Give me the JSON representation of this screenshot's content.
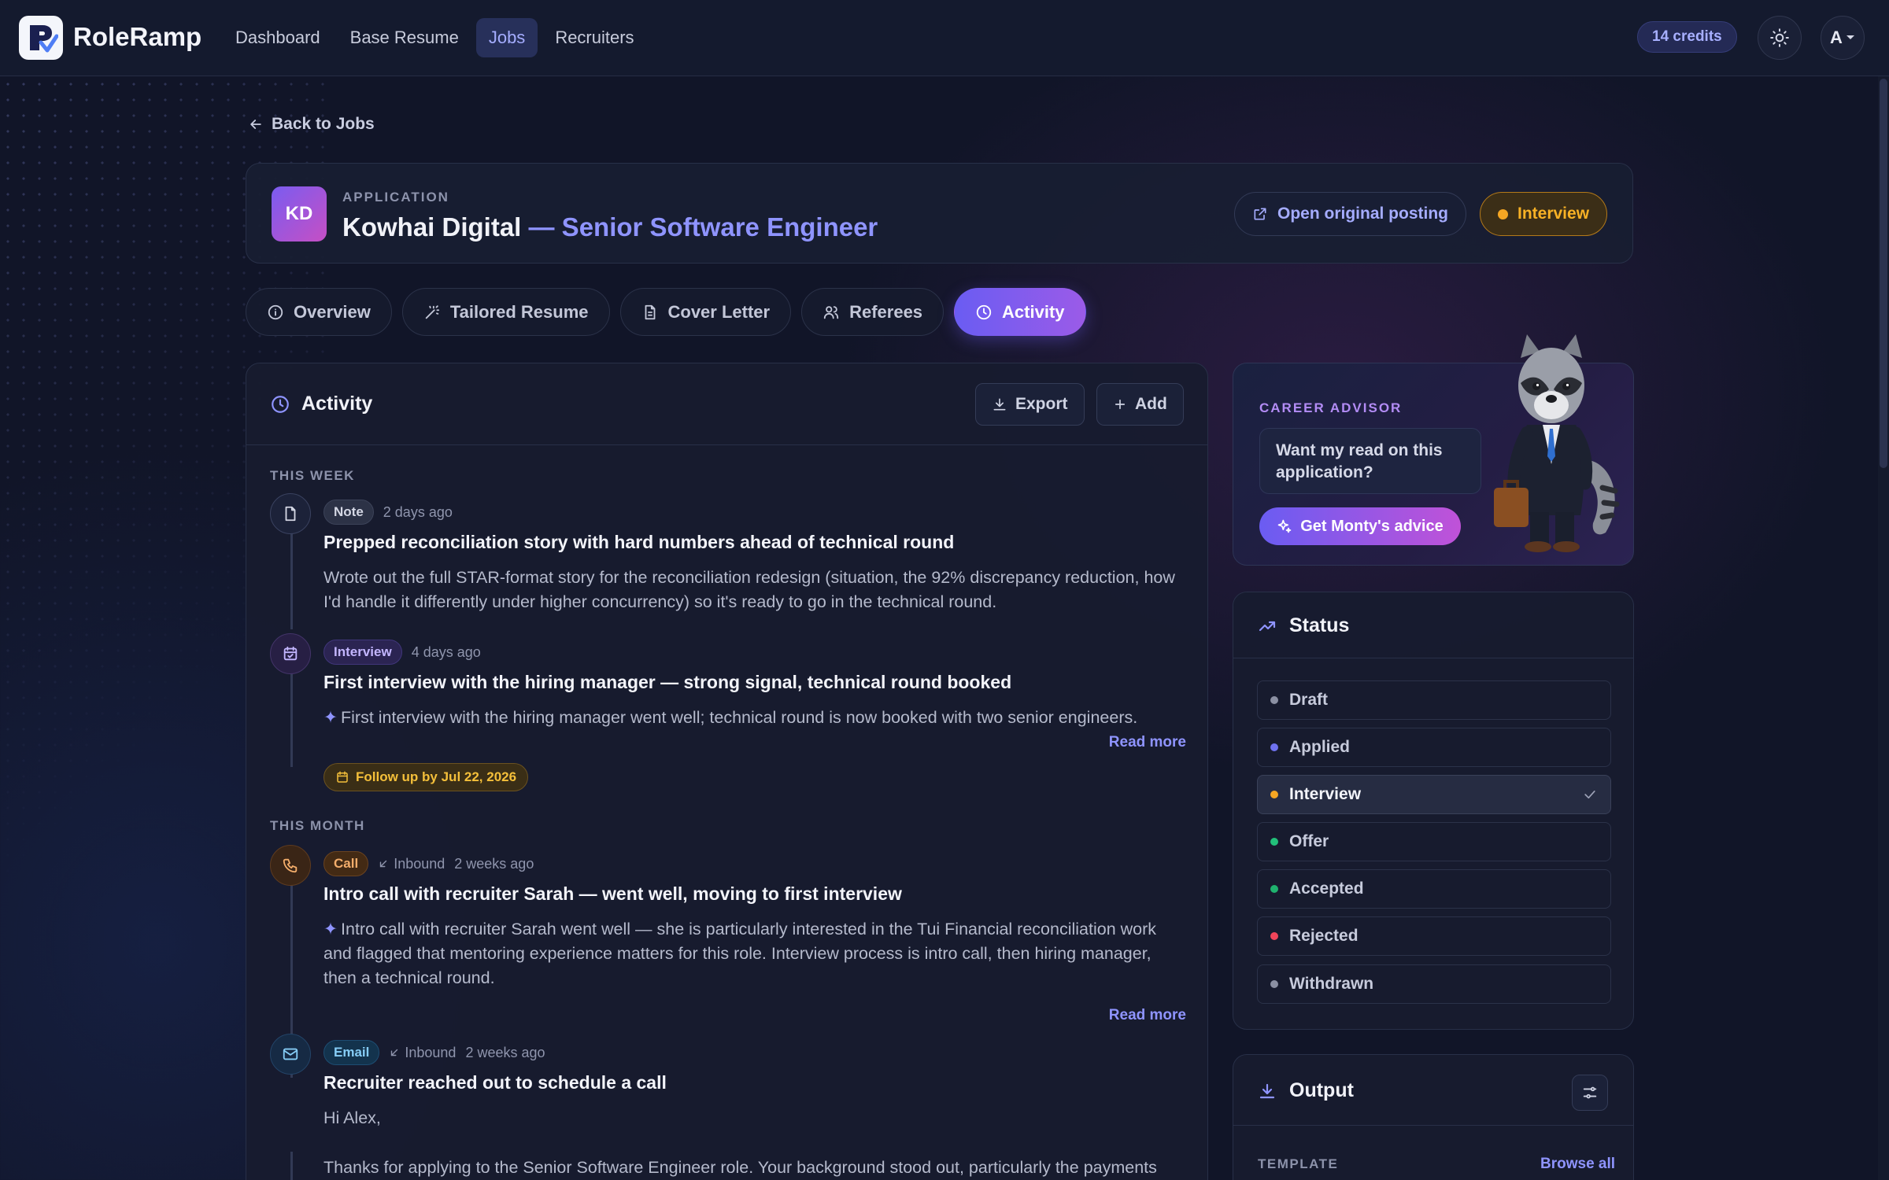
{
  "brand": {
    "name": "RoleRamp"
  },
  "nav": [
    {
      "label": "Dashboard"
    },
    {
      "label": "Base Resume"
    },
    {
      "label": "Jobs",
      "active": true
    },
    {
      "label": "Recruiters"
    }
  ],
  "account": {
    "credits": "14 credits",
    "avatar_initial": "A"
  },
  "back_link": "Back to Jobs",
  "application": {
    "label": "APPLICATION",
    "initials": "KD",
    "company": "Kowhai Digital",
    "role": " — Senior Software Engineer",
    "open_posting": "Open original posting",
    "status": "Interview"
  },
  "tabs": [
    {
      "label": "Overview",
      "icon": "info-icon"
    },
    {
      "label": "Tailored Resume",
      "icon": "magic-wand-icon"
    },
    {
      "label": "Cover Letter",
      "icon": "document-icon"
    },
    {
      "label": "Referees",
      "icon": "people-icon"
    },
    {
      "label": "Activity",
      "icon": "clock-icon",
      "active": true
    }
  ],
  "activity": {
    "title": "Activity",
    "export_label": "Export",
    "add_label": "Add",
    "sections": [
      "THIS WEEK",
      "THIS MONTH"
    ],
    "entries": [
      {
        "type": "Note",
        "time": "2 days ago",
        "title": "Prepped reconciliation story with hard numbers ahead of technical round",
        "body": "Wrote out the full STAR-format story for the reconciliation redesign (situation, the 92% discrepancy reduction, how I'd handle it differently under higher concurrency) so it's ready to go in the technical round."
      },
      {
        "type": "Interview",
        "time": "4 days ago",
        "title": "First interview with the hiring manager — strong signal, technical round booked",
        "body": "First interview with the hiring manager went well; technical round is now booked with two senior engineers.",
        "read_more": "Read more",
        "follow_up": "Follow up by Jul 22, 2026"
      },
      {
        "type": "Call",
        "direction": "Inbound",
        "time": "2 weeks ago",
        "title": "Intro call with recruiter Sarah — went well, moving to first interview",
        "body": "Intro call with recruiter Sarah went well — she is particularly interested in the Tui Financial reconciliation work and flagged that mentoring experience matters for this role. Interview process is intro call, then hiring manager, then a technical round.",
        "read_more": "Read more"
      },
      {
        "type": "Email",
        "direction": "Inbound",
        "time": "2 weeks ago",
        "title": "Recruiter reached out to schedule a call",
        "greeting": "Hi Alex,",
        "body": "Thanks for applying to the Senior Software Engineer role. Your background stood out, particularly the payments"
      }
    ]
  },
  "advisor": {
    "label": "CAREER ADVISOR",
    "prompt": "Want my read on this application?",
    "button": "Get Monty's advice"
  },
  "status_panel": {
    "title": "Status",
    "items": [
      {
        "label": "Draft",
        "color": "#8b90a3"
      },
      {
        "label": "Applied",
        "color": "#6f72f0"
      },
      {
        "label": "Interview",
        "color": "#f5a623",
        "selected": true
      },
      {
        "label": "Offer",
        "color": "#22c07a"
      },
      {
        "label": "Accepted",
        "color": "#1fb26e"
      },
      {
        "label": "Rejected",
        "color": "#f0455a"
      },
      {
        "label": "Withdrawn",
        "color": "#8b90a3"
      }
    ]
  },
  "output_panel": {
    "title": "Output",
    "template_label": "TEMPLATE",
    "browse_all": "Browse all"
  }
}
